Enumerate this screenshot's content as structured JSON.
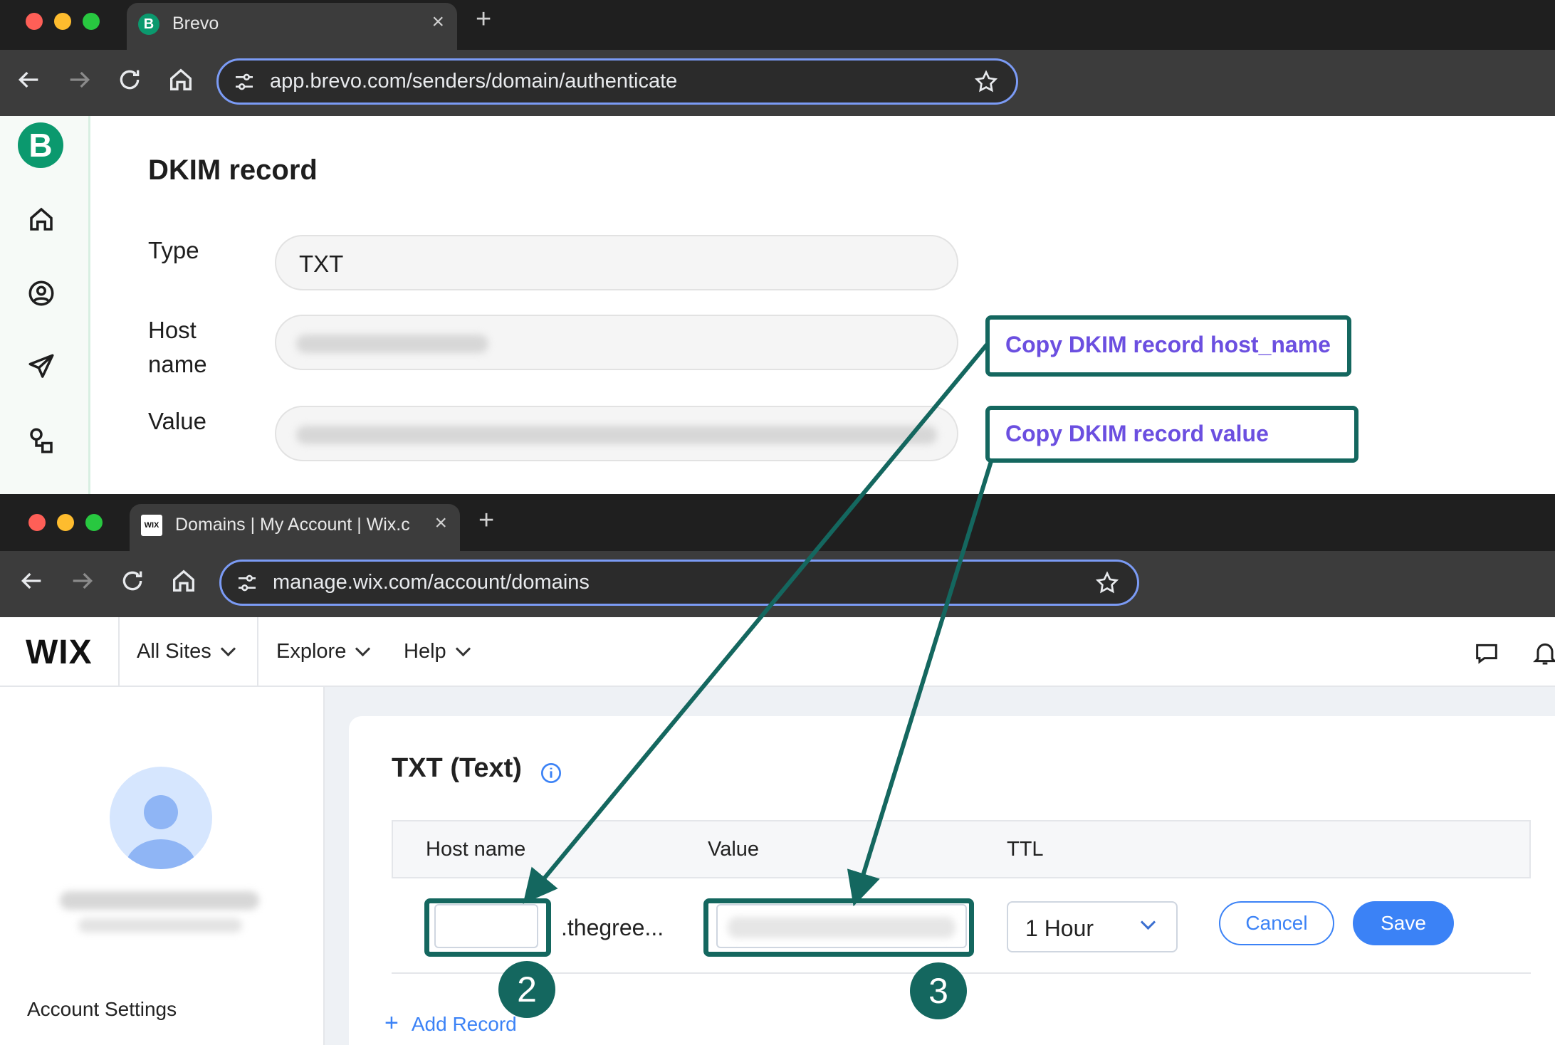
{
  "brevo_browser": {
    "tab_title": "Brevo",
    "favicon_letter": "B",
    "url": "app.brevo.com/senders/domain/authenticate"
  },
  "brevo_page": {
    "heading": "DKIM record",
    "fields": [
      {
        "label": "Type",
        "value": "TXT"
      },
      {
        "label": "Host\nname",
        "value": ""
      },
      {
        "label": "Value",
        "value": ""
      }
    ],
    "sidebar_icons": [
      "home-icon",
      "contacts-icon",
      "send-icon",
      "automation-icon"
    ]
  },
  "callouts": {
    "host_name": "Copy DKIM record host_name",
    "value": "Copy DKIM record value"
  },
  "wix_browser": {
    "tab_title": "Domains | My Account | Wix.c",
    "favicon_text": "WIX",
    "url": "manage.wix.com/account/domains"
  },
  "wix_page": {
    "logo": "WIX",
    "menu": [
      "All Sites",
      "Explore",
      "Help"
    ],
    "sidebar": {
      "account_settings": "Account Settings"
    },
    "section_title": "TXT (Text)",
    "table": {
      "headers": [
        "Host name",
        "Value",
        "TTL"
      ],
      "row": {
        "host_suffix": ".thegree...",
        "ttl": "1 Hour"
      }
    },
    "buttons": {
      "cancel": "Cancel",
      "save": "Save"
    },
    "add_record": "Add Record"
  },
  "steps": [
    "2",
    "3"
  ],
  "colors": {
    "callout_border": "#14675f",
    "callout_text": "#6b4fe0",
    "brevo_green": "#0b996e",
    "wix_blue": "#3b82f6",
    "url_focus": "#7b9bf5"
  }
}
